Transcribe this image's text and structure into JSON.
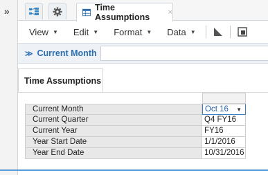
{
  "rail": {
    "expand_glyph": "»"
  },
  "tabs": {
    "icon_tab_1": "hierarchy-icon",
    "icon_tab_2": "gear-icon",
    "active": {
      "label": "Time Assumptions",
      "close_glyph": "×",
      "icon": "form-grid-icon"
    }
  },
  "menubar": {
    "items": [
      {
        "label": "View",
        "caret": "▼"
      },
      {
        "label": "Edit",
        "caret": "▼"
      },
      {
        "label": "Format",
        "caret": "▼"
      },
      {
        "label": "Data",
        "caret": "▼"
      }
    ],
    "tools": [
      "chart-icon",
      "window-icon"
    ]
  },
  "pov": {
    "toggle_glyph": "≫",
    "label": "Current Month"
  },
  "form": {
    "tab_label": "Time Assumptions"
  },
  "grid": {
    "rows": [
      {
        "label": "Current Month",
        "value": "Oct 16",
        "editable": true
      },
      {
        "label": "Current Quarter",
        "value": "Q4 FY16"
      },
      {
        "label": "Current Year",
        "value": "FY16"
      },
      {
        "label": "Year Start Date",
        "value": "1/1/2016"
      },
      {
        "label": "Year End Date",
        "value": "10/31/2016"
      }
    ],
    "select_caret": "▼"
  },
  "colors": {
    "accent": "#2c6fb3",
    "highlight_border": "#3b82c4",
    "bottom_rule": "#5b9bd5"
  }
}
